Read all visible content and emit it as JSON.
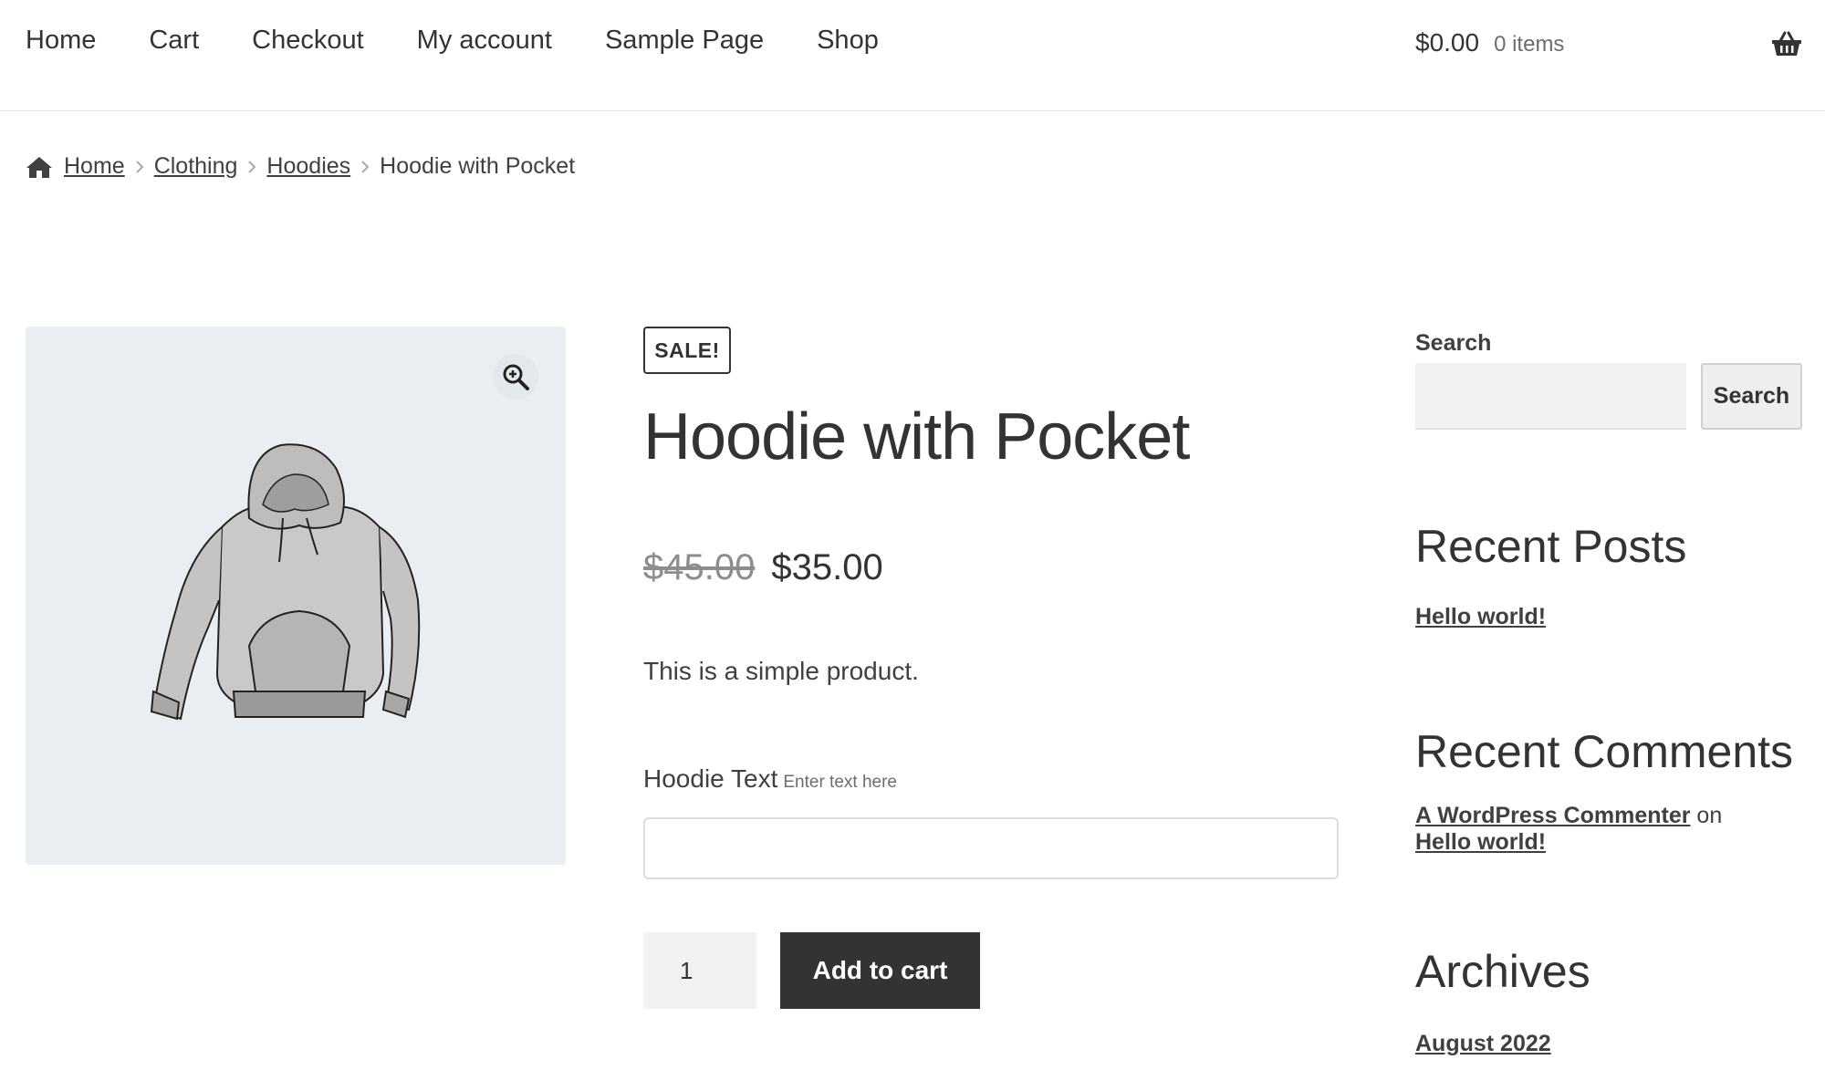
{
  "nav": {
    "items": [
      "Home",
      "Cart",
      "Checkout",
      "My account",
      "Sample Page",
      "Shop"
    ]
  },
  "cart": {
    "total": "$0.00",
    "count": "0 items",
    "icon": "basket-icon"
  },
  "breadcrumb": {
    "icon": "home-icon",
    "links": [
      "Home",
      "Clothing",
      "Hoodies"
    ],
    "current": "Hoodie with Pocket"
  },
  "product": {
    "image_alt": "hoodie",
    "zoom_icon": "zoom-in-icon",
    "sale_badge": "SALE!",
    "title": "Hoodie with Pocket",
    "price_old": "$45.00",
    "price_new": "$35.00",
    "short_description": "This is a simple product.",
    "field_label": "Hoodie Text",
    "field_hint": "Enter text here",
    "field_value": "",
    "quantity": "1",
    "add_to_cart": "Add to cart"
  },
  "sidebar": {
    "search_label": "Search",
    "search_value": "",
    "search_button": "Search",
    "recent_posts_title": "Recent Posts",
    "recent_posts": [
      "Hello world!"
    ],
    "recent_comments_title": "Recent Comments",
    "comment_author": "A WordPress Commenter",
    "comment_on": "on",
    "comment_post": "Hello world!",
    "archives_title": "Archives",
    "archives": [
      "August 2022"
    ]
  },
  "colors": {
    "text": "#333333",
    "muted": "#6d6d6d",
    "image_bg": "#eaeef2",
    "button_dark": "#333333"
  }
}
